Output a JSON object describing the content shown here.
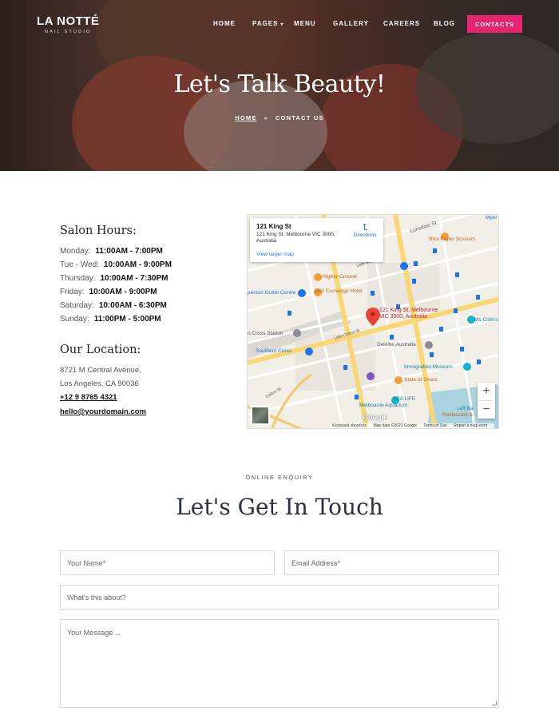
{
  "brand": {
    "name": "LA NOTTÉ",
    "tagline": "NAIL STUDIO"
  },
  "nav": {
    "items": [
      "HOME",
      "PAGES",
      "MENU",
      "GALLERY",
      "CAREERS",
      "BLOG"
    ],
    "cta": "CONTACTS"
  },
  "hero": {
    "title": "Let's Talk Beauty!",
    "breadcrumb": {
      "home": "HOME",
      "separator": "»",
      "current": "CONTACT US"
    }
  },
  "hours": {
    "heading": "Salon Hours:",
    "rows": [
      {
        "day": "Monday:",
        "time": "11:00AM - 7:00PM"
      },
      {
        "day": "Tue - Wed:",
        "time": "10:00AM - 9:00PM"
      },
      {
        "day": "Thursday:",
        "time": "10:00AM - 7:30PM"
      },
      {
        "day": "Friday:",
        "time": "10:00AM - 9:00PM"
      },
      {
        "day": "Saturday:",
        "time": "10:00AM - 6:30PM"
      },
      {
        "day": "Sunday:",
        "time": "11:00PM - 5:00PM"
      }
    ]
  },
  "location": {
    "heading": "Our Location:",
    "address_line1": "8721 M Central Avenue,",
    "address_line2": "Los Angeles, CA 90036",
    "phone": "+12 9 8765 4321",
    "email": "hello@yourdomain.com"
  },
  "map": {
    "card_title": "121 King St",
    "card_address": "121 King St, Melbourne VIC 3000, Australia",
    "directions": "Directions",
    "larger_map": "View larger map",
    "pin_label_1": "121 King St, Melbourne",
    "pin_label_2": "VIC 3000, Australia",
    "labels": {
      "myer": "Myer",
      "lonsdale": "Lonsdale St",
      "rice_paper": "Rice Paper Scissors",
      "little_bourke": "Little Bourke St",
      "higher_ground": "Higher Ground",
      "spencer_outlet": "pencer Outlet Centre",
      "mail_exchange": "Mail Exchange Hotel",
      "ms_collins": "Ms Collins",
      "cross_station": "n Cross Station",
      "little_collins": "Little Collins St",
      "southern_cross": "Southern Cross",
      "deloitte": "Deloitte Australia",
      "immigration": "Immigration Museum",
      "state_of_grace": "State of Grace",
      "collins_st": "Collins St",
      "sea_life": "SEA LIFE",
      "aquarium": "Melbourne Aquarium",
      "left_bank": "Left Ba",
      "restaurant": "Restaurant &",
      "google": "Google"
    },
    "footer": [
      "Keyboard shortcuts",
      "Map data ©2021 Google",
      "Terms of Use",
      "Report a map error"
    ],
    "zoom_in": "+",
    "zoom_out": "−"
  },
  "enquiry": {
    "eyebrow": "ONLINE ENQUIRY",
    "title": "Let's Get In Touch",
    "name_placeholder": "Your Name*",
    "email_placeholder": "Email Address*",
    "subject_placeholder": "What's this about?",
    "message_placeholder": "Your Message ..."
  }
}
